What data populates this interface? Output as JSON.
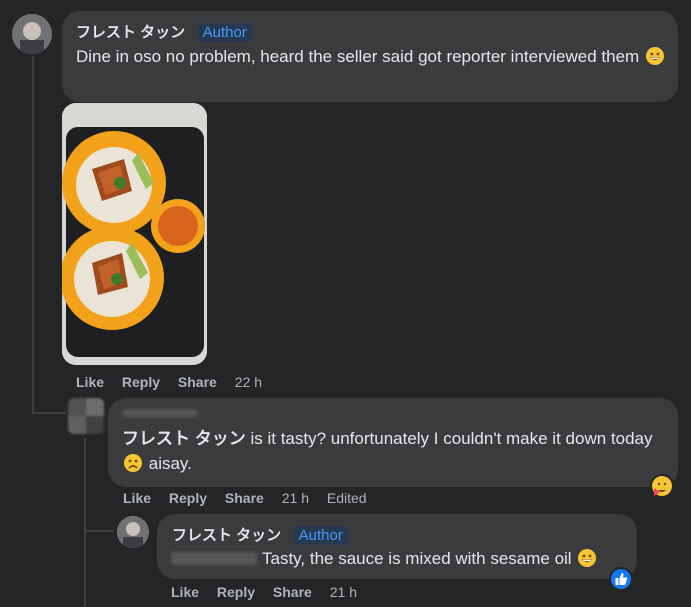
{
  "comments": [
    {
      "author": "フレスト タッン",
      "badge": "Author",
      "text": "Dine in oso no problem, heard the seller said got reporter interviewed them",
      "actions": {
        "like": "Like",
        "reply": "Reply",
        "share": "Share",
        "time": "22 h"
      }
    },
    {
      "mention": "フレスト タッン",
      "text_before_emoji": "is it tasty? unfortunately I couldn't make it down today",
      "text_after_emoji": "aisay.",
      "actions": {
        "like": "Like",
        "reply": "Reply",
        "share": "Share",
        "time": "21 h",
        "edited": "Edited"
      }
    },
    {
      "author": "フレスト タッン",
      "badge": "Author",
      "text": "Tasty, the sauce is mixed with sesame oil",
      "actions": {
        "like": "Like",
        "reply": "Reply",
        "share": "Share",
        "time": "21 h"
      }
    }
  ],
  "icons": {
    "grin": "grinning-face-emoji",
    "frown": "frowning-face-emoji",
    "care": "care-reaction-icon",
    "like": "like-reaction-icon",
    "photo": "food-photo"
  },
  "colors": {
    "background": "#242526",
    "bubble": "#3a3b3c",
    "badge_text": "#4599ff",
    "badge_bg": "#263951",
    "like_blue": "#1877f2"
  }
}
